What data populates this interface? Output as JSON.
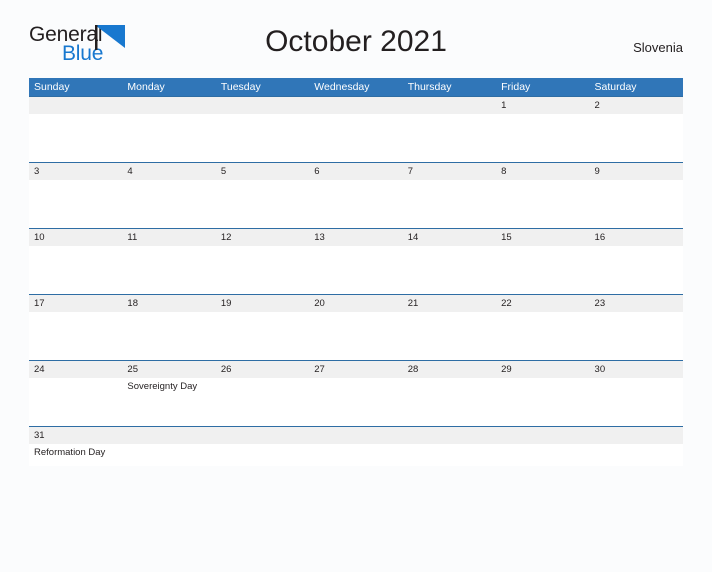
{
  "brand": {
    "name_part1": "General",
    "name_part2": "Blue",
    "flag_icon": "triangle-flag-icon"
  },
  "header": {
    "title": "October 2021",
    "country": "Slovenia"
  },
  "colors": {
    "header_blue": "#3076b8",
    "row_divider_blue": "#2e6da4",
    "date_band_gray": "#f0f0f0",
    "logo_blue": "#1878cf",
    "text_dark": "#231f20",
    "page_background": "#fbfcfd"
  },
  "calendar": {
    "weekdays": [
      "Sunday",
      "Monday",
      "Tuesday",
      "Wednesday",
      "Thursday",
      "Friday",
      "Saturday"
    ],
    "weeks": [
      {
        "days": [
          {
            "date": "",
            "event": ""
          },
          {
            "date": "",
            "event": ""
          },
          {
            "date": "",
            "event": ""
          },
          {
            "date": "",
            "event": ""
          },
          {
            "date": "",
            "event": ""
          },
          {
            "date": "1",
            "event": ""
          },
          {
            "date": "2",
            "event": ""
          }
        ]
      },
      {
        "days": [
          {
            "date": "3",
            "event": ""
          },
          {
            "date": "4",
            "event": ""
          },
          {
            "date": "5",
            "event": ""
          },
          {
            "date": "6",
            "event": ""
          },
          {
            "date": "7",
            "event": ""
          },
          {
            "date": "8",
            "event": ""
          },
          {
            "date": "9",
            "event": ""
          }
        ]
      },
      {
        "days": [
          {
            "date": "10",
            "event": ""
          },
          {
            "date": "11",
            "event": ""
          },
          {
            "date": "12",
            "event": ""
          },
          {
            "date": "13",
            "event": ""
          },
          {
            "date": "14",
            "event": ""
          },
          {
            "date": "15",
            "event": ""
          },
          {
            "date": "16",
            "event": ""
          }
        ]
      },
      {
        "days": [
          {
            "date": "17",
            "event": ""
          },
          {
            "date": "18",
            "event": ""
          },
          {
            "date": "19",
            "event": ""
          },
          {
            "date": "20",
            "event": ""
          },
          {
            "date": "21",
            "event": ""
          },
          {
            "date": "22",
            "event": ""
          },
          {
            "date": "23",
            "event": ""
          }
        ]
      },
      {
        "days": [
          {
            "date": "24",
            "event": ""
          },
          {
            "date": "25",
            "event": "Sovereignty Day"
          },
          {
            "date": "26",
            "event": ""
          },
          {
            "date": "27",
            "event": ""
          },
          {
            "date": "28",
            "event": ""
          },
          {
            "date": "29",
            "event": ""
          },
          {
            "date": "30",
            "event": ""
          }
        ]
      },
      {
        "short": true,
        "days": [
          {
            "date": "31",
            "event": "Reformation Day"
          },
          {
            "date": "",
            "event": ""
          },
          {
            "date": "",
            "event": ""
          },
          {
            "date": "",
            "event": ""
          },
          {
            "date": "",
            "event": ""
          },
          {
            "date": "",
            "event": ""
          },
          {
            "date": "",
            "event": ""
          }
        ]
      }
    ]
  }
}
